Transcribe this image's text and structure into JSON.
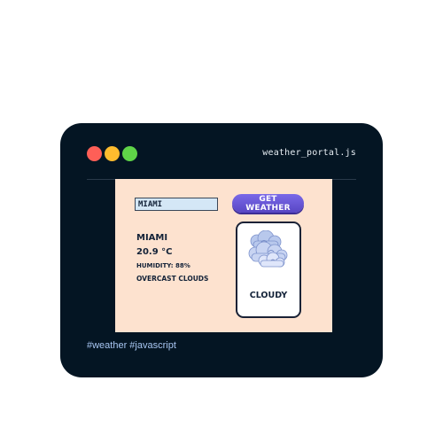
{
  "window": {
    "filename": "weather_portal.js",
    "tags": "#weather #javascript"
  },
  "search": {
    "value": "MIAMI",
    "button_label": "GET WEATHER"
  },
  "weather": {
    "city": "MIAMI",
    "temperature": "20.9 °C",
    "humidity": "HUMIDITY: 88%",
    "description": "OVERCAST CLOUDS",
    "condition": "CLOUDY",
    "icon": "cloud-icon"
  },
  "colors": {
    "window_bg": "#041523",
    "panel_bg": "#fde2cf",
    "button_accent": "#6655d8",
    "traffic_red": "#fe5f57",
    "traffic_yellow": "#febc2e",
    "traffic_green": "#5fd448",
    "tag_color": "#a8c6f2"
  }
}
